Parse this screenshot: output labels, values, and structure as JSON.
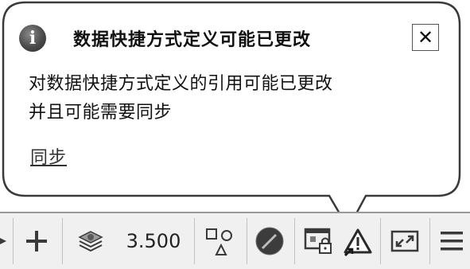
{
  "balloon": {
    "title": "数据快捷方式定义可能已更改",
    "message_line1": "对数据快捷方式定义的引用可能已更改",
    "message_line2": "并且可能需要同步",
    "link_label": "同步",
    "close_glyph": "✕",
    "info_glyph": "i"
  },
  "statusbar": {
    "scale_value": "3.500",
    "icons": [
      "dropdown-arrow-icon",
      "plus-icon",
      "layers-icon",
      "shapes-icon",
      "color-circle-icon",
      "lock-ui-icon",
      "warning-icon",
      "fullscreen-icon",
      "menu-icon"
    ]
  },
  "colors": {
    "background": "#ffffff",
    "text": "#111111",
    "statusbar_bg": "#f0f0f0",
    "icon_dark": "#3a3a3a"
  }
}
